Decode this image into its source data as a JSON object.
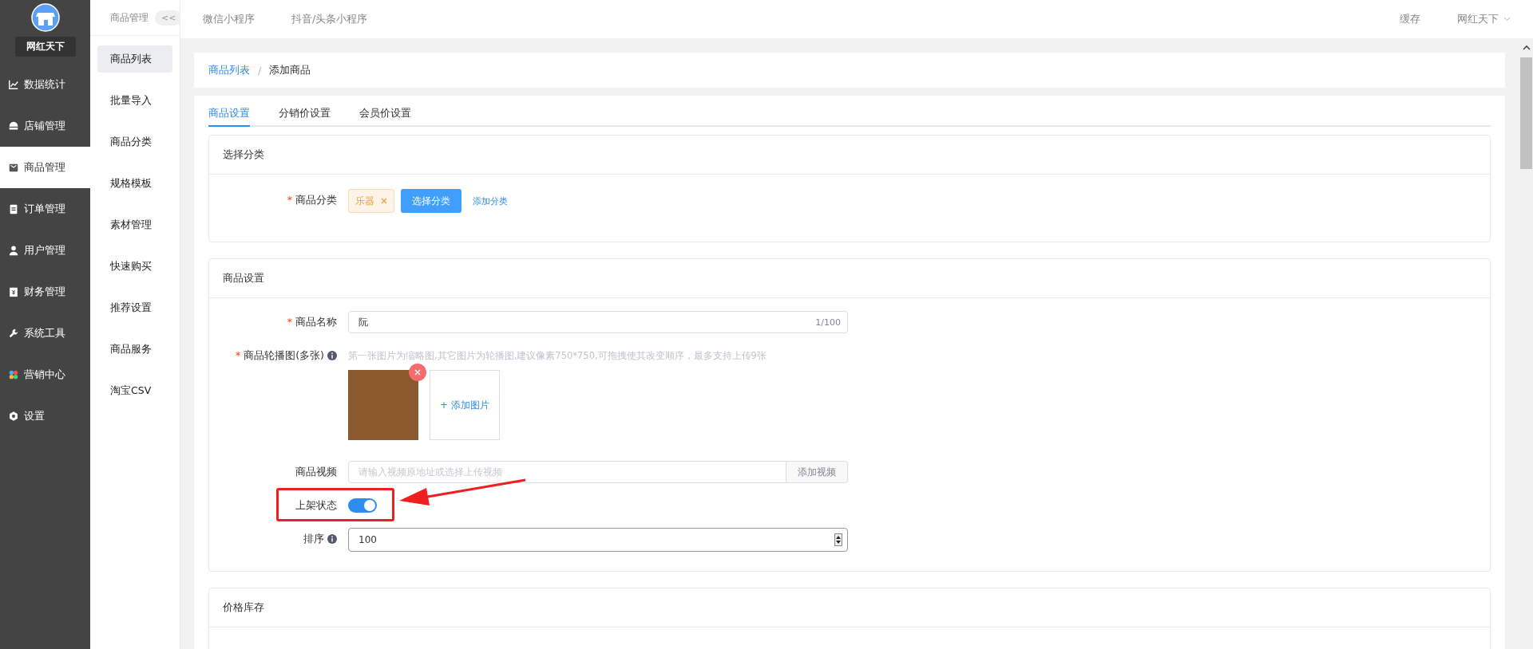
{
  "brand": {
    "name": "网红天下"
  },
  "sidebar": {
    "items": [
      {
        "label": "数据统计",
        "selected": false
      },
      {
        "label": "店铺管理",
        "selected": false
      },
      {
        "label": "商品管理",
        "selected": true
      },
      {
        "label": "订单管理",
        "selected": false
      },
      {
        "label": "用户管理",
        "selected": false
      },
      {
        "label": "财务管理",
        "selected": false
      },
      {
        "label": "系统工具",
        "selected": false
      },
      {
        "label": "营销中心",
        "selected": false
      },
      {
        "label": "设置",
        "selected": false
      }
    ]
  },
  "subnav": {
    "title": "商品管理",
    "collapse": "<<",
    "items": [
      {
        "label": "商品列表",
        "selected": true
      },
      {
        "label": "批量导入",
        "selected": false
      },
      {
        "label": "商品分类",
        "selected": false
      },
      {
        "label": "规格模板",
        "selected": false
      },
      {
        "label": "素材管理",
        "selected": false
      },
      {
        "label": "快速购买",
        "selected": false
      },
      {
        "label": "推荐设置",
        "selected": false
      },
      {
        "label": "商品服务",
        "selected": false
      },
      {
        "label": "淘宝CSV",
        "selected": false
      }
    ]
  },
  "topbar": {
    "links": [
      "微信小程序",
      "抖音/头条小程序"
    ],
    "cache": "缓存",
    "user": "网红天下"
  },
  "breadcrumb": {
    "separator": "/",
    "items": [
      {
        "label": "商品列表",
        "link": true
      },
      {
        "label": "添加商品",
        "link": false
      }
    ]
  },
  "tabs": [
    {
      "label": "商品设置",
      "selected": true
    },
    {
      "label": "分销价设置",
      "selected": false
    },
    {
      "label": "会员价设置",
      "selected": false
    }
  ],
  "category_section": {
    "title": "选择分类",
    "label": "商品分类",
    "required_mark": "*",
    "tag": "乐器",
    "select_button": "选择分类",
    "add_link": "添加分类"
  },
  "product_section": {
    "title": "商品设置",
    "name": {
      "label": "商品名称",
      "required_mark": "*",
      "value": "阮",
      "counter": "1/100"
    },
    "images": {
      "label": "商品轮播图(多张)",
      "required_mark": "*",
      "hint": "第一张图片为缩略图,其它图片为轮播图,建议像素750*750,可拖拽使其改变顺序，最多支持上传9张",
      "add": "+ 添加图片"
    },
    "video": {
      "label": "商品视频",
      "placeholder": "请输入视频原地址或选择上传视频",
      "button": "添加视频"
    },
    "status": {
      "label": "上架状态",
      "on": true
    },
    "sort": {
      "label": "排序",
      "value": "100"
    }
  },
  "price_section": {
    "title": "价格库存"
  }
}
